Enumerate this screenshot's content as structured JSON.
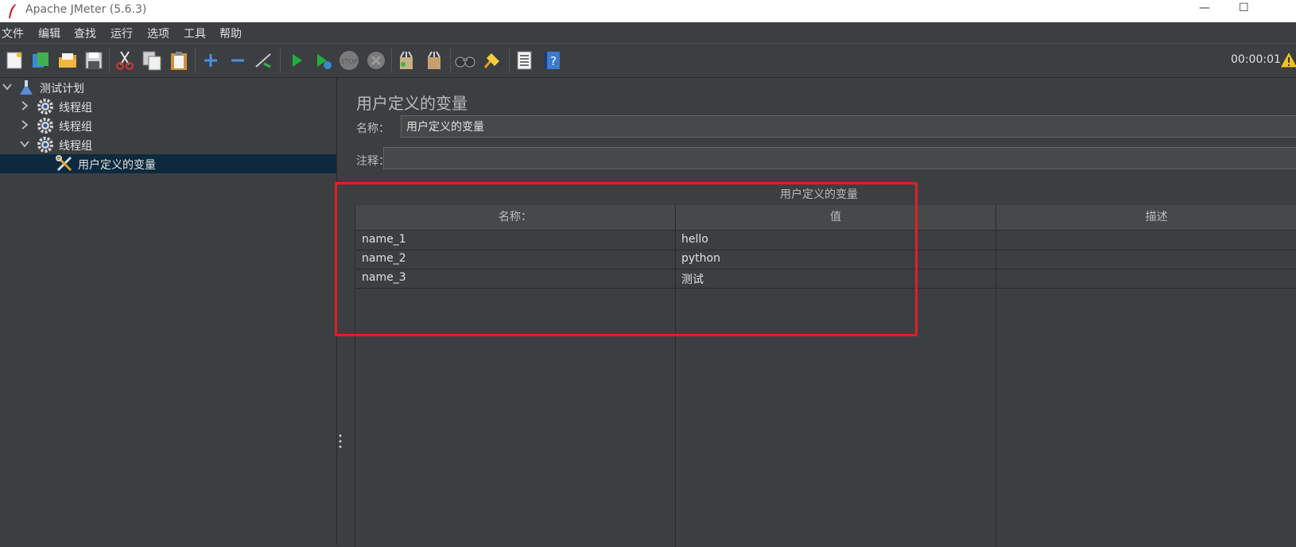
{
  "window": {
    "title": "Apache JMeter (5.6.3)",
    "minimize_glyph": "—",
    "maximize_glyph": "☐"
  },
  "menu": [
    "文件",
    "编辑",
    "查找",
    "运行",
    "选项",
    "工具",
    "帮助"
  ],
  "toolbar": {
    "icons": [
      "new-icon",
      "templates-icon",
      "open-icon",
      "save-icon",
      "cut-icon",
      "copy-icon",
      "paste-icon",
      "expand-icon",
      "collapse-icon",
      "toggle-icon",
      "start-icon",
      "start-no-pause-icon",
      "stop-icon",
      "shutdown-icon",
      "clear-icon",
      "clear-all-icon",
      "search-icon",
      "reset-search-icon",
      "function-helper-icon",
      "help-icon"
    ],
    "timer": "00:00:01"
  },
  "tree": {
    "items": [
      {
        "label": "测试计划",
        "icon": "flask-icon",
        "expanded": true
      },
      {
        "label": "线程组",
        "icon": "gear-icon",
        "expanded": false
      },
      {
        "label": "线程组",
        "icon": "gear-icon",
        "expanded": false
      },
      {
        "label": "线程组",
        "icon": "gear-icon",
        "expanded": true
      },
      {
        "label": "用户定义的变量",
        "icon": "wrench-icon",
        "selected": true
      }
    ]
  },
  "panel": {
    "title": "用户定义的变量",
    "name_label": "名称：",
    "name_value": "用户定义的变量",
    "comment_label": "注释：",
    "comment_value": ""
  },
  "table": {
    "caption": "用户定义的变量",
    "headers": [
      "名称：",
      "值",
      "描述"
    ],
    "rows": [
      {
        "name": "name_1",
        "value": "hello",
        "desc": ""
      },
      {
        "name": "name_2",
        "value": "python",
        "desc": ""
      },
      {
        "name": "name_3",
        "value": "测试",
        "desc": ""
      }
    ]
  },
  "colors": {
    "background": "#3c3f41",
    "selection": "#0d293e",
    "highlight": "#e02020"
  }
}
